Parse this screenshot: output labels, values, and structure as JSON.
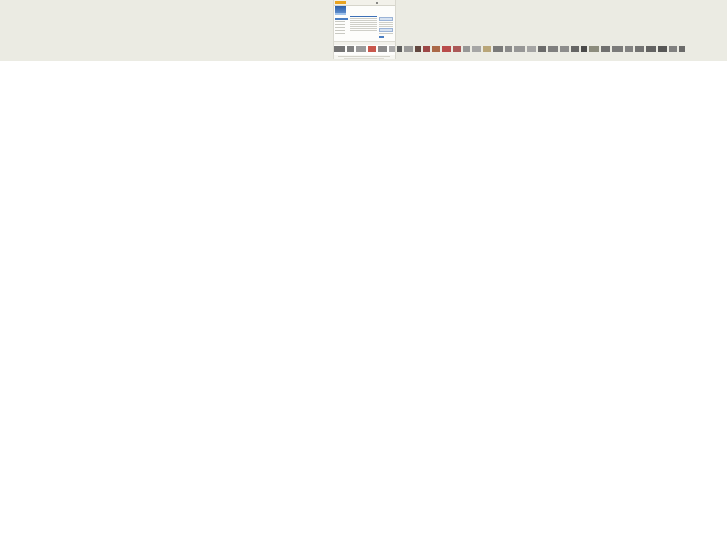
{
  "page": {
    "background_color": "#ebebe3"
  },
  "mini_page": {
    "tagline": "",
    "header_link": "",
    "sidebar_heading": "",
    "main_title": "",
    "footer_text": ""
  },
  "thumbnail_strip": {
    "thumbnails": [
      {
        "color": "#5d5d5d",
        "kind": "image"
      },
      {
        "color": "#6a6a6a",
        "kind": "image"
      },
      {
        "color": "#8a8a8a",
        "kind": "image"
      },
      {
        "color": "#c0392b",
        "kind": "image"
      },
      {
        "color": "#777777",
        "kind": "image"
      },
      {
        "color": "#999999",
        "kind": "image"
      },
      {
        "color": "#444444",
        "kind": "image"
      },
      {
        "color": "#8c8c8c",
        "kind": "image"
      },
      {
        "color": "#4a2a22",
        "kind": "image"
      },
      {
        "color": "#8f2b2b",
        "kind": "image"
      },
      {
        "color": "#a0522d",
        "kind": "image"
      },
      {
        "color": "#b03030",
        "kind": "image"
      },
      {
        "color": "#a04040",
        "kind": "image"
      },
      {
        "color": "#888888",
        "kind": "image"
      },
      {
        "color": "#9a9a9a",
        "kind": "image"
      },
      {
        "color": "#b09a66",
        "kind": "image"
      },
      {
        "color": "#666666",
        "kind": "image"
      },
      {
        "color": "#7a7a7a",
        "kind": "image"
      },
      {
        "color": "#888888",
        "kind": "image"
      },
      {
        "color": "#999999",
        "kind": "image"
      },
      {
        "color": "#555555",
        "kind": "image"
      },
      {
        "color": "#6c6c6c",
        "kind": "image"
      },
      {
        "color": "#7c7c7c",
        "kind": "image"
      },
      {
        "color": "#4f4f4f",
        "kind": "image"
      },
      {
        "color": "#2e2e2e",
        "kind": "image"
      },
      {
        "color": "#7b7b6b",
        "kind": "image"
      },
      {
        "color": "#5a5a5a",
        "kind": "image"
      },
      {
        "color": "#676767",
        "kind": "image"
      },
      {
        "color": "#707070",
        "kind": "image"
      },
      {
        "color": "#5e5e5e",
        "kind": "image"
      },
      {
        "color": "#4b4b4b",
        "kind": "image"
      },
      {
        "color": "#3d3d3d",
        "kind": "image"
      },
      {
        "color": "#6e6e6e",
        "kind": "image"
      },
      {
        "color": "#555555",
        "kind": "image"
      }
    ]
  }
}
